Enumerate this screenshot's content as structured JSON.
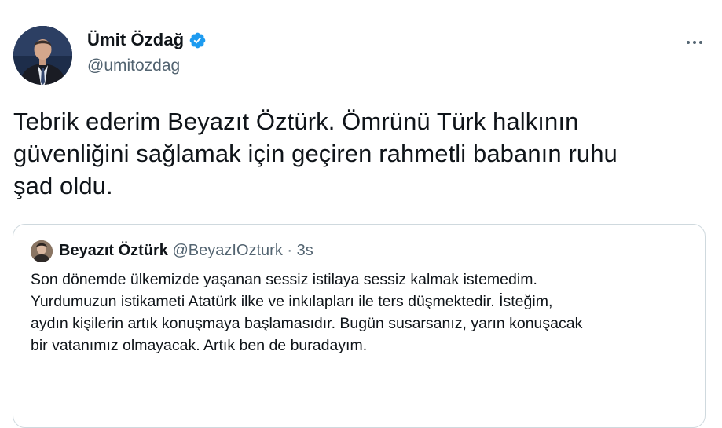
{
  "author": {
    "display_name": "Ümit Özdağ",
    "handle": "@umitozdag",
    "verified": true
  },
  "tweet": {
    "lines": [
      "Tebrik ederim Beyazıt Öztürk. Ömrünü Türk halkının",
      "güvenliğini sağlamak için geçiren rahmetli babanın ruhu",
      "şad oldu."
    ]
  },
  "quoted": {
    "display_name": "Beyazıt Öztürk",
    "handle": "@BeyazIOzturk",
    "separator": "·",
    "time": "3s",
    "lines": [
      "Son dönemde ülkemizde yaşanan sessiz istilaya sessiz kalmak istemedim.",
      "Yurdumuzun istikameti Atatürk ilke ve inkılapları ile ters düşmektedir. İsteğim,",
      "aydın kişilerin artık konuşmaya başlamasıdır. Bugün susarsanız, yarın konuşacak",
      "bir vatanımız olmayacak. Artık ben de buradayım."
    ]
  },
  "icons": {
    "verified": "verified-badge-icon",
    "more": "more-options-icon"
  },
  "colors": {
    "verified_blue": "#1d9bf0",
    "text_primary": "#0f1419",
    "text_secondary": "#536471",
    "border": "#cfd9de"
  }
}
